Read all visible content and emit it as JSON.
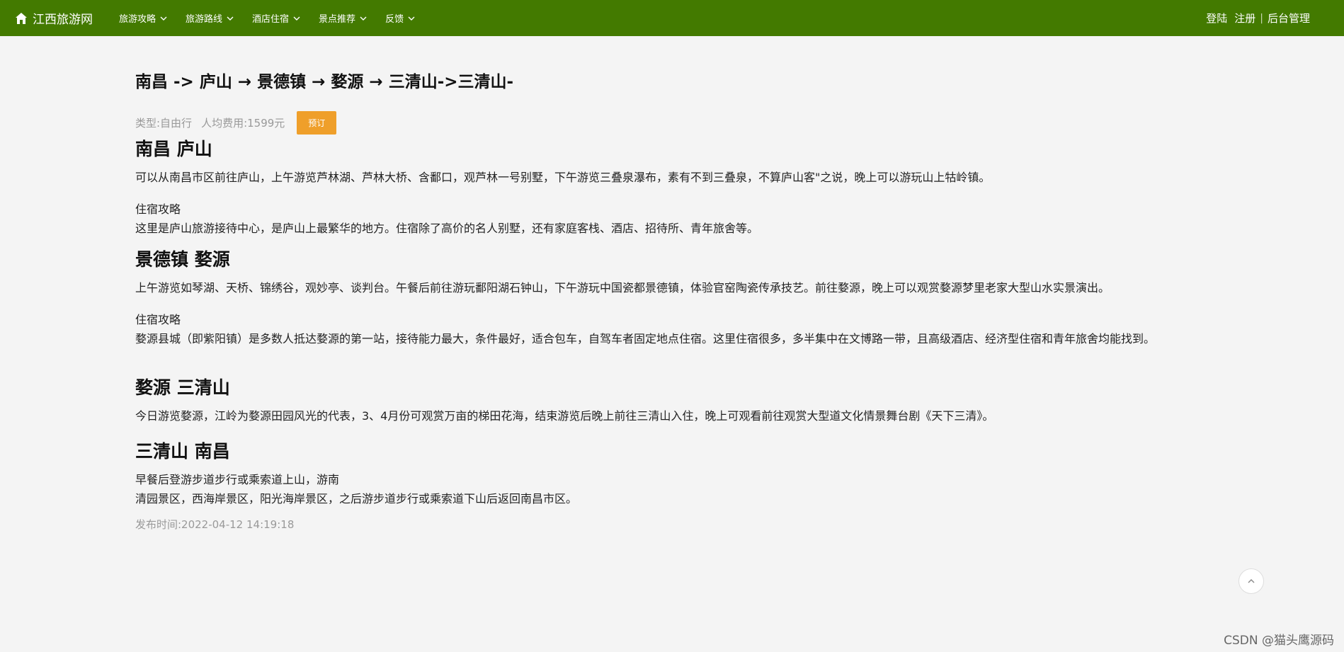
{
  "header": {
    "brand": "江西旅游网",
    "nav": [
      {
        "label": "旅游攻略"
      },
      {
        "label": "旅游路线"
      },
      {
        "label": "酒店住宿"
      },
      {
        "label": "景点推荐"
      },
      {
        "label": "反馈"
      }
    ],
    "login": "登陆",
    "register": "注册",
    "separator": "|",
    "admin": "后台管理",
    "bar_color": "#437a00"
  },
  "route": {
    "title": "南昌 -> 庐山 → 景德镇 → 婺源 → 三清山->三清山-",
    "type": "类型:自由行",
    "fee": "人均费用:1599元",
    "book_label": "预订"
  },
  "days": [
    {
      "heading": "南昌 庐山",
      "text": "可以从南昌市区前往庐山，上午游览芦林湖、芦林大桥、含鄱口，观芦林一号别墅，下午游览三叠泉瀑布，素有不到三叠泉，不算庐山客\"之说，晚上可以游玩山上牯岭镇。",
      "stay_label": "住宿攻略",
      "stay_text": "这里是庐山旅游接待中心，是庐山上最繁华的地方。住宿除了高价的名人别墅，还有家庭客栈、酒店、招待所、青年旅舍等。"
    },
    {
      "heading": "景德镇 婺源",
      "text": "上午游览如琴湖、天桥、锦绣谷，观妙亭、谈判台。午餐后前往游玩鄱阳湖石钟山，下午游玩中国瓷都景德镇，体验官窑陶瓷传承技艺。前往婺源，晚上可以观赏婺源梦里老家大型山水实景演出。",
      "stay_label": "住宿攻略",
      "stay_text": "婺源县城（即紫阳镇）是多数人抵达婺源的第一站，接待能力最大，条件最好，适合包车，自驾车者固定地点住宿。这里住宿很多，多半集中在文博路一带，且高级酒店、经济型住宿和青年旅舍均能找到。"
    },
    {
      "heading": "婺源 三清山",
      "text": "今日游览婺源，江岭为婺源田园风光的代表，3、4月份可观赏万亩的梯田花海，结束游览后晚上前往三清山入住，晚上可观看前往观赏大型道文化情景舞台剧《天下三清》。"
    },
    {
      "heading": "三清山 南昌",
      "text": "早餐后登游步道步行或乘索道上山，游南",
      "text2": "清园景区，西海岸景区，阳光海岸景区，之后游步道步行或乘索道下山后返回南昌市区。"
    }
  ],
  "publish_time": "发布时间:2022-04-12 14:19:18",
  "watermark": "CSDN @猫头鹰源码",
  "colors": {
    "book_button": "#ef9f2a",
    "background": "#f4f4f4"
  }
}
